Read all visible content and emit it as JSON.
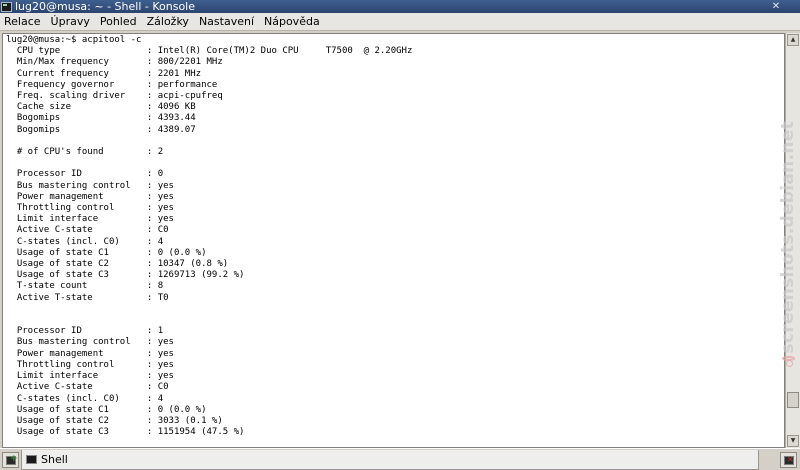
{
  "window": {
    "title": "lug20@musa: ~ - Shell - Konsole",
    "close_glyph": "✕"
  },
  "menubar": {
    "items": [
      "Relace",
      "Úpravy",
      "Pohled",
      "Záložky",
      "Nastavení",
      "Nápověda"
    ]
  },
  "terminal": {
    "lines": [
      "lug20@musa:~$ acpitool -c",
      "  CPU type                : Intel(R) Core(TM)2 Duo CPU     T7500  @ 2.20GHz",
      "  Min/Max frequency       : 800/2201 MHz",
      "  Current frequency       : 2201 MHz",
      "  Frequency governor      : performance",
      "  Freq. scaling driver    : acpi-cpufreq",
      "  Cache size              : 4096 KB",
      "  Bogomips                : 4393.44",
      "  Bogomips                : 4389.07",
      "",
      "  # of CPU's found        : 2",
      "",
      "  Processor ID            : 0",
      "  Bus mastering control   : yes",
      "  Power management        : yes",
      "  Throttling control      : yes",
      "  Limit interface         : yes",
      "  Active C-state          : C0",
      "  C-states (incl. C0)     : 4",
      "  Usage of state C1       : 0 (0.0 %)",
      "  Usage of state C2       : 10347 (0.8 %)",
      "  Usage of state C3       : 1269713 (99.2 %)",
      "  T-state count           : 8",
      "  Active T-state          : T0",
      "",
      "",
      "  Processor ID            : 1",
      "  Bus mastering control   : yes",
      "  Power management        : yes",
      "  Throttling control      : yes",
      "  Limit interface         : yes",
      "  Active C-state          : C0",
      "  C-states (incl. C0)     : 4",
      "  Usage of state C1       : 0 (0.0 %)",
      "  Usage of state C2       : 3033 (0.1 %)",
      "  Usage of state C3       : 1151954 (47.5 %)"
    ]
  },
  "scrollbar": {
    "position_fraction": 0.93,
    "up_glyph": "▲",
    "down_glyph": "▼"
  },
  "watermark": {
    "text": "screenshots.debian.net"
  },
  "tabbar": {
    "tabs": [
      {
        "label": "Shell",
        "active": true
      }
    ]
  },
  "icons": {
    "window": "terminal-icon",
    "new_tab": "new-tab-icon",
    "close_tab": "close-tab-icon",
    "tab": "terminal-icon"
  },
  "colors": {
    "titlebar": "#2b4470",
    "terminal_bg": "#ffffff",
    "terminal_fg": "#000000",
    "chrome": "#d4d0c8"
  }
}
